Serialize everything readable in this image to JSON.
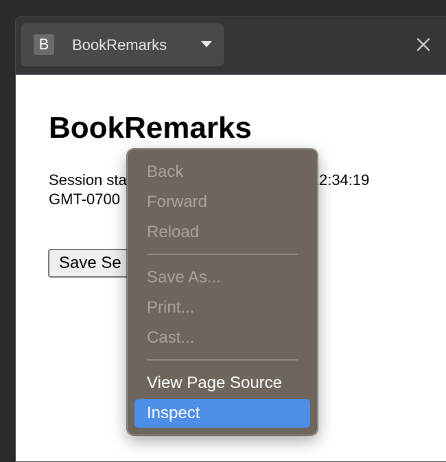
{
  "tab": {
    "favicon_letter": "B",
    "title": "BookRemarks"
  },
  "page": {
    "title": "BookRemarks",
    "session_text": "Session sta                                        12:34:19 GMT-0700",
    "session_line1_left": "Session sta",
    "session_line1_right": "12:34:19",
    "session_line2": "GMT-0700",
    "save_button_label": "Save Se"
  },
  "context_menu": {
    "items": [
      {
        "label": "Back",
        "enabled": false
      },
      {
        "label": "Forward",
        "enabled": false
      },
      {
        "label": "Reload",
        "enabled": false
      },
      {
        "label": "Save As...",
        "enabled": false
      },
      {
        "label": "Print...",
        "enabled": false
      },
      {
        "label": "Cast...",
        "enabled": false
      },
      {
        "label": "View Page Source",
        "enabled": true
      },
      {
        "label": "Inspect",
        "enabled": true,
        "highlighted": true
      }
    ]
  },
  "colors": {
    "menu_background": "#6e665d",
    "menu_highlight": "#4d8ee8",
    "titlebar": "#35363a",
    "tab": "#48494d"
  },
  "icons": {
    "tab_dropdown": "chevron-down-icon",
    "close": "close-icon",
    "favicon": "favicon-icon"
  }
}
